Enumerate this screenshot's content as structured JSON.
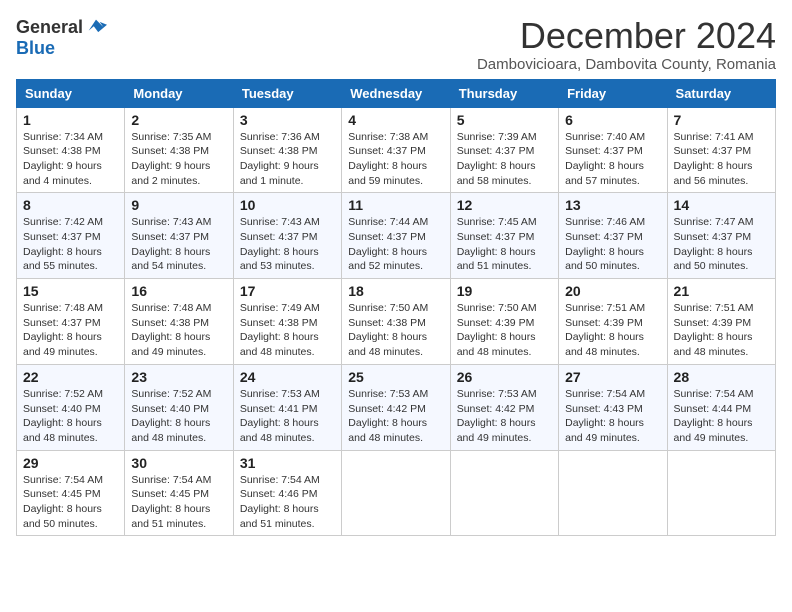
{
  "logo": {
    "general": "General",
    "blue": "Blue"
  },
  "title": {
    "month": "December 2024",
    "location": "Dambovicioara, Dambovita County, Romania"
  },
  "days_of_week": [
    "Sunday",
    "Monday",
    "Tuesday",
    "Wednesday",
    "Thursday",
    "Friday",
    "Saturday"
  ],
  "weeks": [
    [
      {
        "day": "1",
        "info": "Sunrise: 7:34 AM\nSunset: 4:38 PM\nDaylight: 9 hours\nand 4 minutes."
      },
      {
        "day": "2",
        "info": "Sunrise: 7:35 AM\nSunset: 4:38 PM\nDaylight: 9 hours\nand 2 minutes."
      },
      {
        "day": "3",
        "info": "Sunrise: 7:36 AM\nSunset: 4:38 PM\nDaylight: 9 hours\nand 1 minute."
      },
      {
        "day": "4",
        "info": "Sunrise: 7:38 AM\nSunset: 4:37 PM\nDaylight: 8 hours\nand 59 minutes."
      },
      {
        "day": "5",
        "info": "Sunrise: 7:39 AM\nSunset: 4:37 PM\nDaylight: 8 hours\nand 58 minutes."
      },
      {
        "day": "6",
        "info": "Sunrise: 7:40 AM\nSunset: 4:37 PM\nDaylight: 8 hours\nand 57 minutes."
      },
      {
        "day": "7",
        "info": "Sunrise: 7:41 AM\nSunset: 4:37 PM\nDaylight: 8 hours\nand 56 minutes."
      }
    ],
    [
      {
        "day": "8",
        "info": "Sunrise: 7:42 AM\nSunset: 4:37 PM\nDaylight: 8 hours\nand 55 minutes."
      },
      {
        "day": "9",
        "info": "Sunrise: 7:43 AM\nSunset: 4:37 PM\nDaylight: 8 hours\nand 54 minutes."
      },
      {
        "day": "10",
        "info": "Sunrise: 7:43 AM\nSunset: 4:37 PM\nDaylight: 8 hours\nand 53 minutes."
      },
      {
        "day": "11",
        "info": "Sunrise: 7:44 AM\nSunset: 4:37 PM\nDaylight: 8 hours\nand 52 minutes."
      },
      {
        "day": "12",
        "info": "Sunrise: 7:45 AM\nSunset: 4:37 PM\nDaylight: 8 hours\nand 51 minutes."
      },
      {
        "day": "13",
        "info": "Sunrise: 7:46 AM\nSunset: 4:37 PM\nDaylight: 8 hours\nand 50 minutes."
      },
      {
        "day": "14",
        "info": "Sunrise: 7:47 AM\nSunset: 4:37 PM\nDaylight: 8 hours\nand 50 minutes."
      }
    ],
    [
      {
        "day": "15",
        "info": "Sunrise: 7:48 AM\nSunset: 4:37 PM\nDaylight: 8 hours\nand 49 minutes."
      },
      {
        "day": "16",
        "info": "Sunrise: 7:48 AM\nSunset: 4:38 PM\nDaylight: 8 hours\nand 49 minutes."
      },
      {
        "day": "17",
        "info": "Sunrise: 7:49 AM\nSunset: 4:38 PM\nDaylight: 8 hours\nand 48 minutes."
      },
      {
        "day": "18",
        "info": "Sunrise: 7:50 AM\nSunset: 4:38 PM\nDaylight: 8 hours\nand 48 minutes."
      },
      {
        "day": "19",
        "info": "Sunrise: 7:50 AM\nSunset: 4:39 PM\nDaylight: 8 hours\nand 48 minutes."
      },
      {
        "day": "20",
        "info": "Sunrise: 7:51 AM\nSunset: 4:39 PM\nDaylight: 8 hours\nand 48 minutes."
      },
      {
        "day": "21",
        "info": "Sunrise: 7:51 AM\nSunset: 4:39 PM\nDaylight: 8 hours\nand 48 minutes."
      }
    ],
    [
      {
        "day": "22",
        "info": "Sunrise: 7:52 AM\nSunset: 4:40 PM\nDaylight: 8 hours\nand 48 minutes."
      },
      {
        "day": "23",
        "info": "Sunrise: 7:52 AM\nSunset: 4:40 PM\nDaylight: 8 hours\nand 48 minutes."
      },
      {
        "day": "24",
        "info": "Sunrise: 7:53 AM\nSunset: 4:41 PM\nDaylight: 8 hours\nand 48 minutes."
      },
      {
        "day": "25",
        "info": "Sunrise: 7:53 AM\nSunset: 4:42 PM\nDaylight: 8 hours\nand 48 minutes."
      },
      {
        "day": "26",
        "info": "Sunrise: 7:53 AM\nSunset: 4:42 PM\nDaylight: 8 hours\nand 49 minutes."
      },
      {
        "day": "27",
        "info": "Sunrise: 7:54 AM\nSunset: 4:43 PM\nDaylight: 8 hours\nand 49 minutes."
      },
      {
        "day": "28",
        "info": "Sunrise: 7:54 AM\nSunset: 4:44 PM\nDaylight: 8 hours\nand 49 minutes."
      }
    ],
    [
      {
        "day": "29",
        "info": "Sunrise: 7:54 AM\nSunset: 4:45 PM\nDaylight: 8 hours\nand 50 minutes."
      },
      {
        "day": "30",
        "info": "Sunrise: 7:54 AM\nSunset: 4:45 PM\nDaylight: 8 hours\nand 51 minutes."
      },
      {
        "day": "31",
        "info": "Sunrise: 7:54 AM\nSunset: 4:46 PM\nDaylight: 8 hours\nand 51 minutes."
      },
      {
        "day": "",
        "info": ""
      },
      {
        "day": "",
        "info": ""
      },
      {
        "day": "",
        "info": ""
      },
      {
        "day": "",
        "info": ""
      }
    ]
  ]
}
